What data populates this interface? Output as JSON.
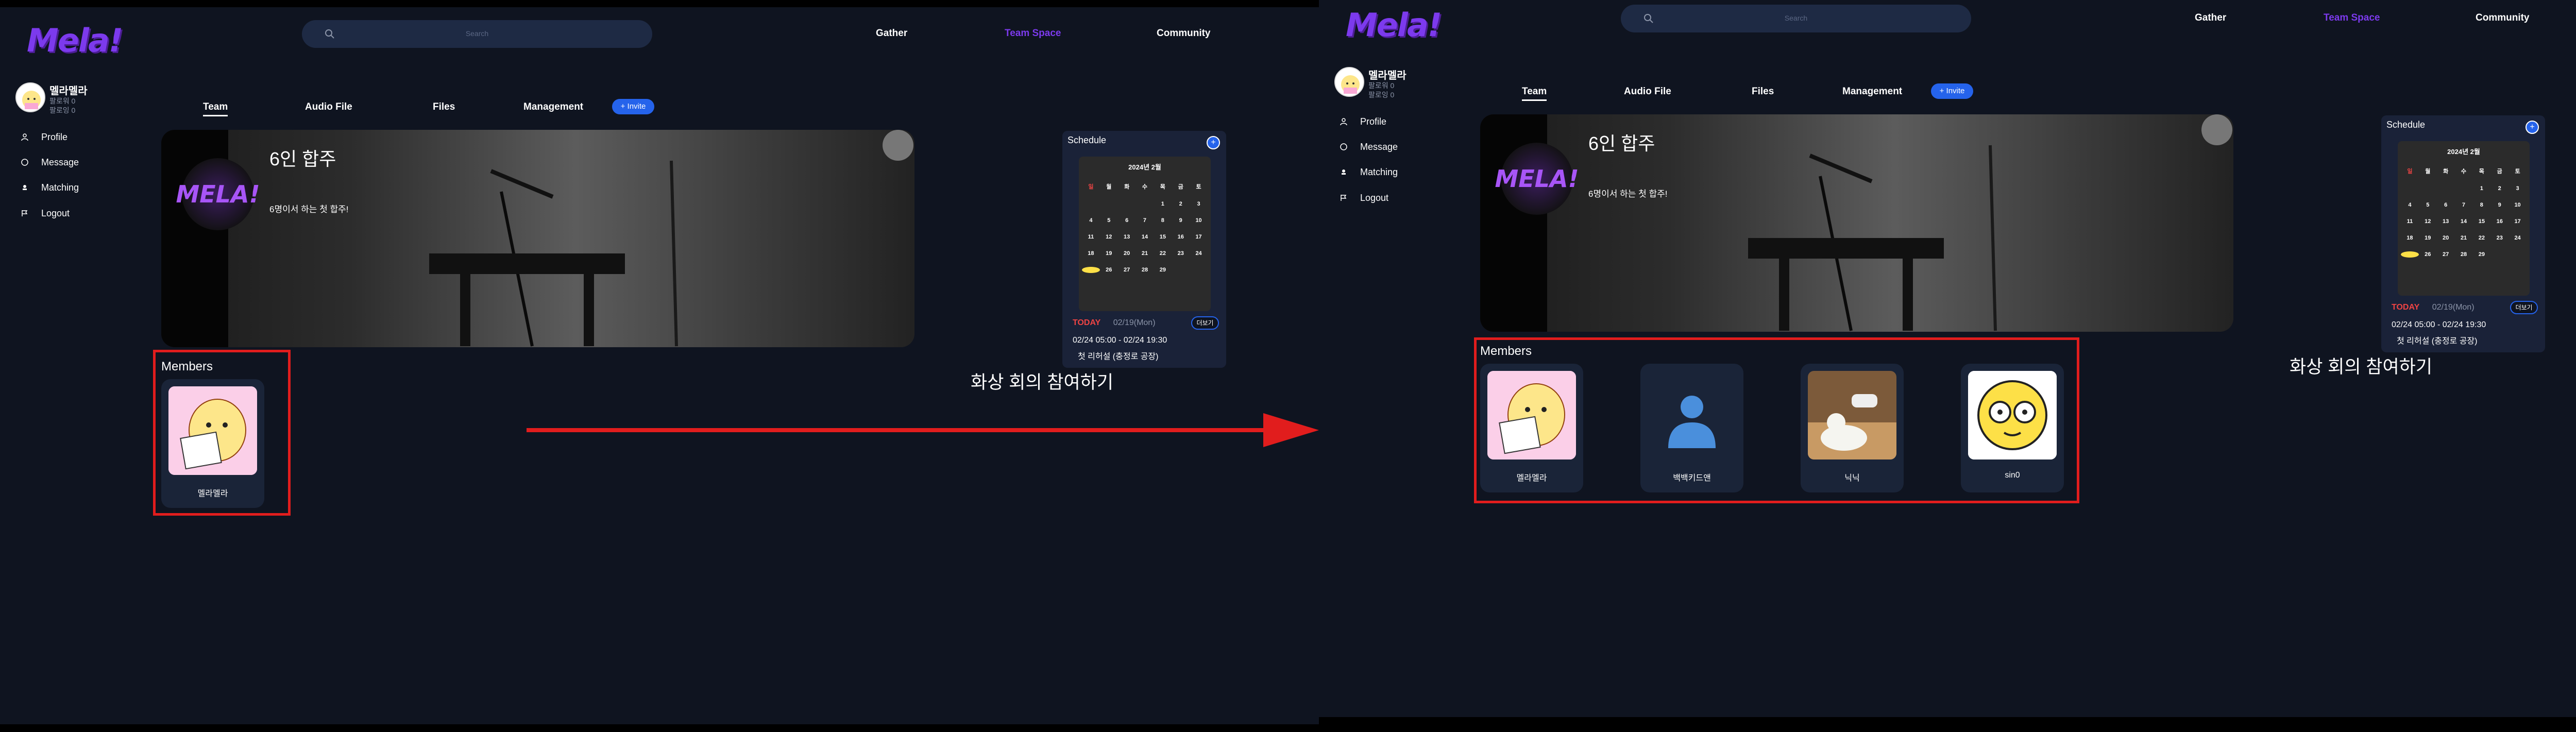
{
  "app": {
    "logo": "Mela!",
    "search_placeholder": "Search",
    "top_nav": [
      "Gather",
      "Team Space",
      "Community"
    ]
  },
  "sidebar": {
    "user_name": "멜라멜라",
    "follower": "팔로워 0",
    "following": "팔로잉 0",
    "items": [
      {
        "label": "Profile",
        "icon": "user-icon"
      },
      {
        "label": "Message",
        "icon": "message-icon"
      },
      {
        "label": "Matching",
        "icon": "matching-icon"
      },
      {
        "label": "Logout",
        "icon": "logout-icon"
      }
    ]
  },
  "tabs": [
    "Team",
    "Audio File",
    "Files",
    "Management"
  ],
  "invite_label": "+ Invite",
  "banner": {
    "logo_text": "MELA!",
    "title": "6인 합주",
    "description": "6명이서 하는 첫 합주!"
  },
  "schedule": {
    "title": "Schedule",
    "plus": "+",
    "month": "2024년 2월",
    "weekdays": [
      "일",
      "월",
      "화",
      "수",
      "목",
      "금",
      "토"
    ],
    "days": [
      "",
      "",
      "",
      "",
      "1",
      "2",
      "3",
      "4",
      "5",
      "6",
      "7",
      "8",
      "9",
      "10",
      "11",
      "12",
      "13",
      "14",
      "15",
      "16",
      "17",
      "18",
      "19",
      "20",
      "21",
      "22",
      "23",
      "24",
      "25",
      "26",
      "27",
      "28",
      "29"
    ],
    "highlighted_day": "24",
    "today_label": "TODAY",
    "today_date": "02/19(Mon)",
    "more_button": "더보기",
    "event_time": "02/24 05:00 - 02/24 19:30",
    "event_name": "첫 리허설 (충정로 공장)"
  },
  "video_call_link": "화상 회의 참여하기",
  "members_title": "Members",
  "before": {
    "members": [
      {
        "name": "멜라멜라",
        "avatar": "sticker-avatar"
      }
    ]
  },
  "after": {
    "members": [
      {
        "name": "멜라멜라",
        "avatar": "sticker-avatar"
      },
      {
        "name": "백백키드앤",
        "avatar": "default-person-icon"
      },
      {
        "name": "닉닉",
        "avatar": "duck-photo"
      },
      {
        "name": "sin0",
        "avatar": "yellow-glasses-face"
      }
    ]
  },
  "colors": {
    "background": "#0f1420",
    "accent": "#7c3aed",
    "button_blue": "#2563eb",
    "highlight_red": "#e11d1d"
  }
}
